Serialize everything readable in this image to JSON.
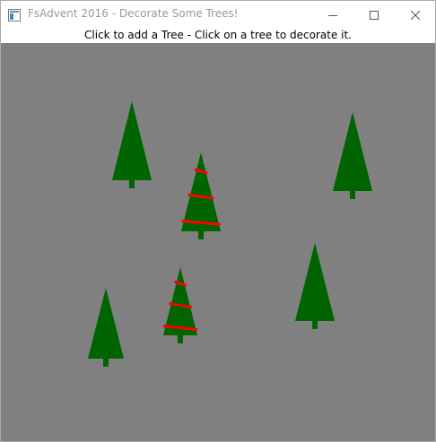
{
  "window": {
    "title": "FsAdvent 2016 - Decorate Some Trees!",
    "icon": "app-window-icon",
    "controls": [
      "minimize-icon",
      "maximize-icon",
      "close-icon"
    ]
  },
  "instructions": "Click to add a Tree - Click on a tree to decorate it.",
  "colors": {
    "canvas": "#808080",
    "tree": "#006400",
    "decoration": "#ff0000"
  },
  "trees": [
    {
      "decorated": false
    },
    {
      "decorated": true
    },
    {
      "decorated": false
    },
    {
      "decorated": false
    },
    {
      "decorated": true
    },
    {
      "decorated": false
    }
  ]
}
